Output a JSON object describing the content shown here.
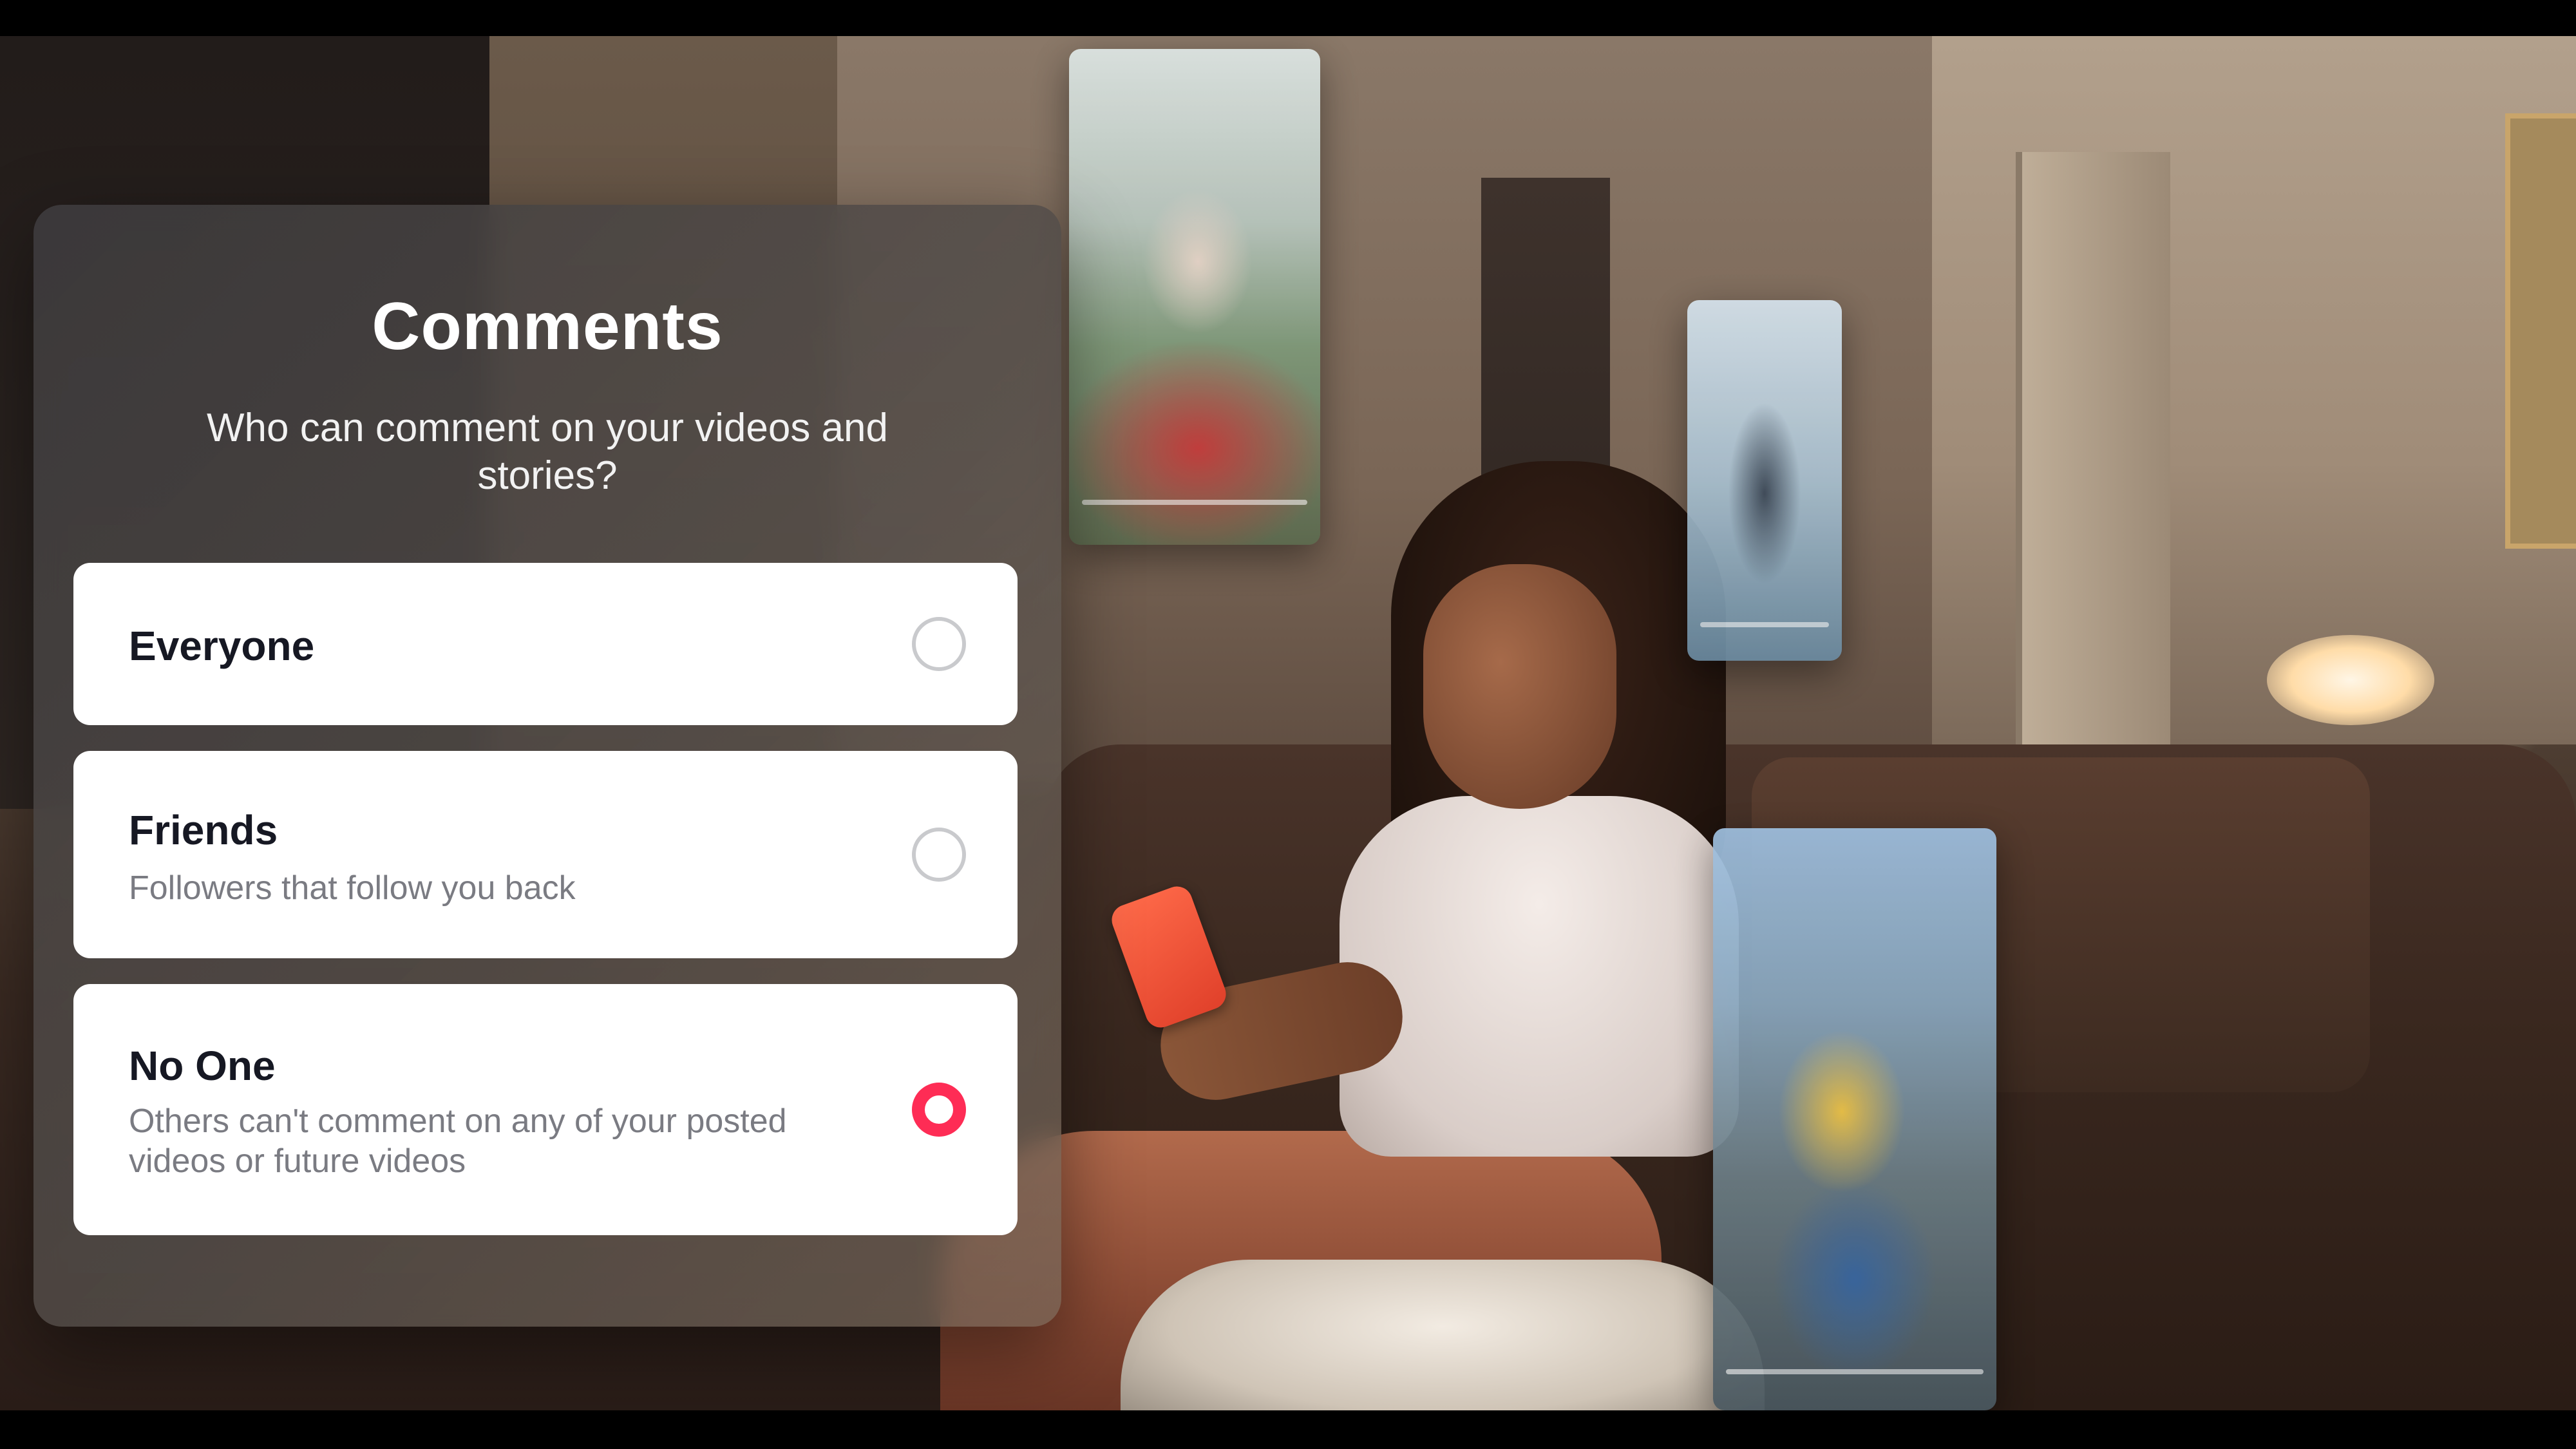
{
  "comments": {
    "title": "Comments",
    "subtitle": "Who can comment on your videos and stories?",
    "options": [
      {
        "label": "Everyone",
        "description": "",
        "selected": false
      },
      {
        "label": "Friends",
        "description": "Followers that follow you back",
        "selected": false
      },
      {
        "label": "No One",
        "description": "Others can't comment on any of your posted videos or future videos",
        "selected": true
      }
    ]
  },
  "colors": {
    "accent": "#fe2c55",
    "card": "#ffffff",
    "label": "#161823",
    "description": "#7a7b82",
    "panel": "#3e3c3e"
  },
  "icons": [
    "radio-unselected-icon",
    "radio-selected-icon"
  ]
}
